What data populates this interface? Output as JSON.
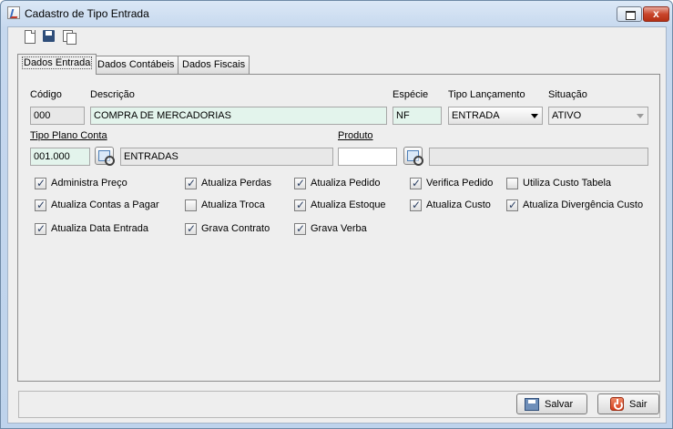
{
  "window": {
    "title": "Cadastro de Tipo Entrada",
    "close_glyph": "x"
  },
  "tabs": [
    "Dados Entrada",
    "Dados Contábeis",
    "Dados Fiscais"
  ],
  "form": {
    "codigo": {
      "label": "Código",
      "value": "000"
    },
    "descricao": {
      "label": "Descrição",
      "value": "COMPRA DE MERCADORIAS"
    },
    "especie": {
      "label": "Espécie",
      "value": "NF"
    },
    "tipo_lancamento": {
      "label": "Tipo Lançamento",
      "value": "ENTRADA"
    },
    "situacao": {
      "label": "Situação",
      "value": "ATIVO"
    },
    "tipo_plano_conta": {
      "label": "Tipo Plano Conta",
      "code": "001.000",
      "description": "ENTRADAS"
    },
    "produto": {
      "label": "Produto",
      "code": "",
      "description": ""
    }
  },
  "checkboxes": [
    {
      "label": "Administra Preço",
      "checked": true
    },
    {
      "label": "Atualiza Perdas",
      "checked": true
    },
    {
      "label": "Atualiza Pedido",
      "checked": true
    },
    {
      "label": "Verifica Pedido",
      "checked": true
    },
    {
      "label": "Utiliza Custo Tabela",
      "checked": false
    },
    {
      "label": "Atualiza Contas a Pagar",
      "checked": true
    },
    {
      "label": "Atualiza Troca",
      "checked": false
    },
    {
      "label": "Atualiza Estoque",
      "checked": true
    },
    {
      "label": "Atualiza Custo",
      "checked": true
    },
    {
      "label": "Atualiza Divergência Custo",
      "checked": true
    },
    {
      "label": "Atualiza Data Entrada",
      "checked": true
    },
    {
      "label": "Grava Contrato",
      "checked": true
    },
    {
      "label": "Grava Verba",
      "checked": true
    }
  ],
  "buttons": {
    "save": "Salvar",
    "exit": "Sair"
  },
  "icons": {
    "toolbar": [
      "new-document-icon",
      "save-icon",
      "copy-icon"
    ],
    "lookup": "lookup-icon",
    "save_button": "save-icon",
    "exit_button": "power-icon"
  }
}
